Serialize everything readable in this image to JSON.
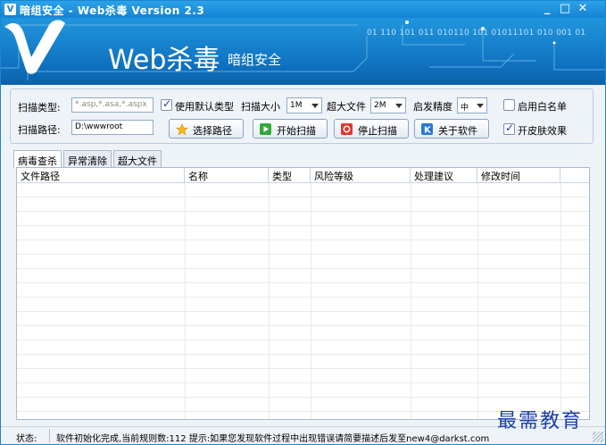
{
  "window": {
    "title": "暗组安全 - Web杀毒  Version 2.3",
    "minimize": "_",
    "maximize": "□",
    "close": "✕"
  },
  "banner": {
    "logo_main": "Web杀毒",
    "logo_sub": "暗组安全",
    "binary_text": "01 110 101 011 010110 101 01011101 010 001 01"
  },
  "options": {
    "scan_type_label": "扫描类型:",
    "scan_type_placeholder": "*.asp,*.asa,*.aspx",
    "use_default_type_label": "使用默认类型",
    "use_default_type_checked": true,
    "scan_size_label": "扫描大小",
    "scan_size_value": "1M",
    "large_file_label": "超大文件",
    "large_file_value": "2M",
    "heuristic_label": "启发精度",
    "heuristic_value": "中",
    "whitelist_label": "启用白名单",
    "whitelist_checked": false,
    "scan_path_label": "扫描路径:",
    "scan_path_value": "D:\\wwwroot",
    "skin_label": "开皮肤效果",
    "skin_checked": true
  },
  "buttons": {
    "choose_path": "选择路径",
    "start_scan": "开始扫描",
    "stop_scan": "停止扫描",
    "about": "关于软件"
  },
  "tabs": [
    {
      "label": "病毒查杀",
      "active": true
    },
    {
      "label": "异常清除",
      "active": false
    },
    {
      "label": "超大文件",
      "active": false
    }
  ],
  "table": {
    "columns": [
      "文件路径",
      "名称",
      "类型",
      "风险等级",
      "处理建议",
      "修改时间"
    ]
  },
  "status": {
    "label": "状态:",
    "text": "软件初始化完成,当前规则数:112 提示:如果您发现软件过程中出现错误请简要描述后发至new4@darkst.com"
  },
  "watermark": "最需教育"
}
